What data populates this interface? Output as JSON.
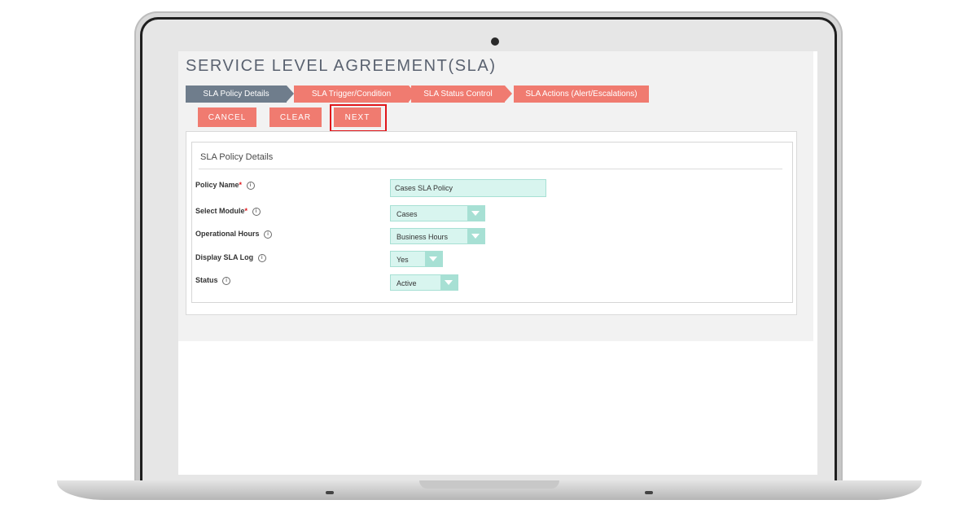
{
  "page": {
    "title": "SERVICE LEVEL AGREEMENT(SLA)"
  },
  "steps": [
    {
      "label": "SLA Policy Details",
      "state": "active"
    },
    {
      "label": "SLA Trigger/Condition",
      "state": "pending"
    },
    {
      "label": "SLA Status Control",
      "state": "pending"
    },
    {
      "label": "SLA Actions (Alert/Escalations)",
      "state": "pending"
    }
  ],
  "buttons": {
    "cancel": "CANCEL",
    "clear": "CLEAR",
    "next": "NEXT"
  },
  "section": {
    "title": "SLA Policy Details"
  },
  "fields": {
    "policy_name": {
      "label": "Policy Name",
      "required_mark": "*",
      "value": "Cases SLA Policy"
    },
    "select_module": {
      "label": "Select Module",
      "required_mark": "*",
      "value": "Cases"
    },
    "operational_hours": {
      "label": "Operational Hours",
      "value": "Business Hours"
    },
    "display_sla_log": {
      "label": "Display SLA Log",
      "value": "Yes"
    },
    "status": {
      "label": "Status",
      "value": "Active"
    }
  },
  "icons": {
    "info": "info-icon",
    "dropdown": "chevron-down-icon",
    "camera": "camera-icon"
  },
  "colors": {
    "accent": "#f07b70",
    "active_step": "#6f7d8c",
    "input_bg": "#d8f5ef",
    "highlight": "#e0161b"
  }
}
